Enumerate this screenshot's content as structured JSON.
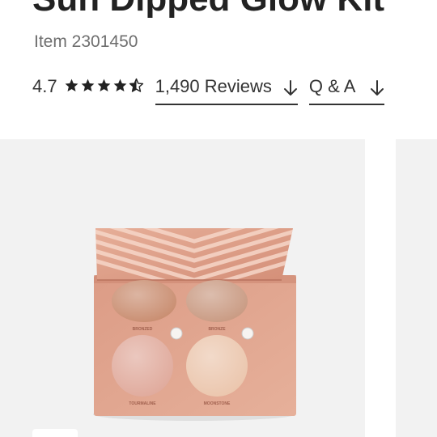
{
  "product": {
    "title": "Sun Dipped Glow Kit",
    "item_number": "Item 2301450"
  },
  "rating": {
    "value": "4.7",
    "stars_filled": 4.7,
    "stars_total": 5,
    "reviews_label": "1,490 Reviews",
    "qa_label": "Q & A"
  },
  "palette": {
    "shades": [
      {
        "name": "BRONZED",
        "color": "#c98d70"
      },
      {
        "name": "BRONZE",
        "color": "#c99a82"
      },
      {
        "name": "TOURMALINE",
        "color": "#e0aa9c"
      },
      {
        "name": "MOONSTONE",
        "color": "#ebc6ad"
      }
    ]
  },
  "colors": {
    "palette_body": "#e4a891",
    "palette_lid": "#dfa08b",
    "text_dark": "#222222",
    "text_muted": "#6e6e6e",
    "gallery_bg": "#f2f2f2"
  }
}
